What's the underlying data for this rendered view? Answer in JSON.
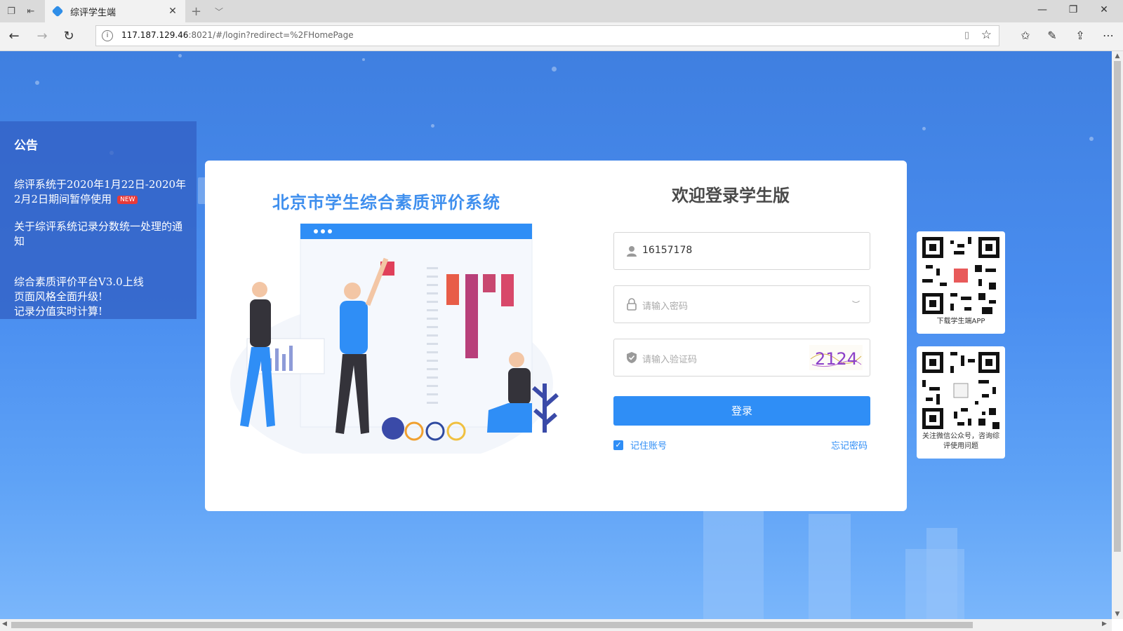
{
  "browser": {
    "tab_title": "综评学生端",
    "url_host": "117.187.129.46",
    "url_rest": ":8021/#/login?redirect=%2FHomePage"
  },
  "notice": {
    "title": "公告",
    "items": [
      {
        "text": "综评系统于2020年1月22日-2020年2月2日期间暂停使用",
        "badge": "NEW"
      },
      {
        "text": "关于综评系统记录分数统一处理的通知"
      },
      {
        "text": "综合素质评价平台V3.0上线\n页面风格全面升级!\n记录分值实时计算!"
      }
    ]
  },
  "login": {
    "system_title": "北京市学生综合素质评价系统",
    "welcome": "欢迎登录学生版",
    "username_value": "16157178",
    "password_placeholder": "请输入密码",
    "captcha_placeholder": "请输入验证码",
    "captcha_text": "2124",
    "submit_label": "登录",
    "remember_label": "记住账号",
    "remember_checked": true,
    "forgot_label": "忘记密码"
  },
  "qr": {
    "app_caption": "下载学生端APP",
    "wechat_caption": "关注微信公众号，咨询综评使用问题"
  },
  "colors": {
    "accent": "#2f8ef6",
    "title_blue": "#3f8fee",
    "badge_red": "#e83a3a"
  }
}
